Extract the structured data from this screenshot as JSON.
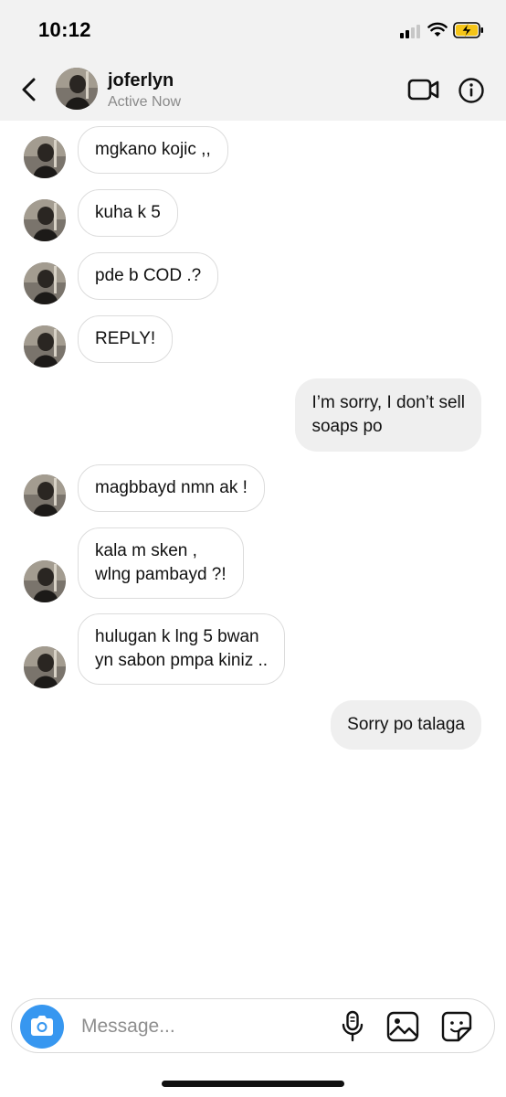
{
  "status_bar": {
    "time": "10:12"
  },
  "header": {
    "contact_name": "joferlyn",
    "contact_status": "Active Now",
    "icons": {
      "back": "chevron-left-icon",
      "video": "video-call-icon",
      "info": "info-icon"
    }
  },
  "messages": [
    {
      "direction": "incoming",
      "text": "mgkano kojic ,,"
    },
    {
      "direction": "incoming",
      "text": "kuha k 5"
    },
    {
      "direction": "incoming",
      "text": "pde b COD .?"
    },
    {
      "direction": "incoming",
      "text": "REPLY!"
    },
    {
      "direction": "outgoing",
      "text": "I’m sorry, I don’t sell\nsoaps po"
    },
    {
      "direction": "incoming",
      "text": "magbbayd nmn ak !"
    },
    {
      "direction": "incoming",
      "text": "kala m sken ,\nwlng pambayd ?!"
    },
    {
      "direction": "incoming",
      "text": "hulugan k lng 5 bwan\nyn sabon pmpa kiniz .."
    },
    {
      "direction": "outgoing",
      "text": "Sorry po talaga"
    }
  ],
  "composer": {
    "placeholder": "Message...",
    "icons": {
      "camera": "camera-icon",
      "mic": "microphone-icon",
      "gallery": "gallery-icon",
      "sticker": "sticker-icon"
    }
  },
  "colors": {
    "accent": "#3797f0",
    "outgoing_bubble": "#efefef",
    "header_bg": "#f2f2f2",
    "battery_charge": "#f5c518"
  }
}
